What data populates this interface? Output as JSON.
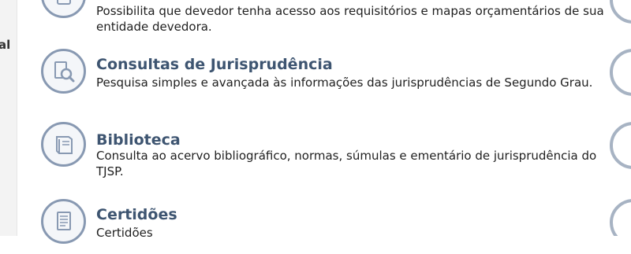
{
  "left_panel": {
    "fragment": "al"
  },
  "items": [
    {
      "title": "",
      "description": "Possibilita que devedor tenha acesso aos requisitórios e mapas orçamentários de sua entidade devedora.",
      "icon": "document-icon"
    },
    {
      "title": "Consultas de Jurisprudência",
      "description": "Pesquisa simples e avançada às informações das jurisprudências de Segundo Grau.",
      "icon": "search-document-icon"
    },
    {
      "title": "Biblioteca",
      "description": "Consulta ao acervo bibliográfico, normas, súmulas e ementário de jurisprudência do TJSP.",
      "icon": "book-icon"
    },
    {
      "title": "Certidões",
      "description": "Certidões",
      "icon": "certificate-icon"
    }
  ],
  "colors": {
    "title": "#3e5571",
    "icon_border": "#8899b2",
    "icon_fill": "#f4f6f9",
    "text": "#1f1f1f"
  }
}
